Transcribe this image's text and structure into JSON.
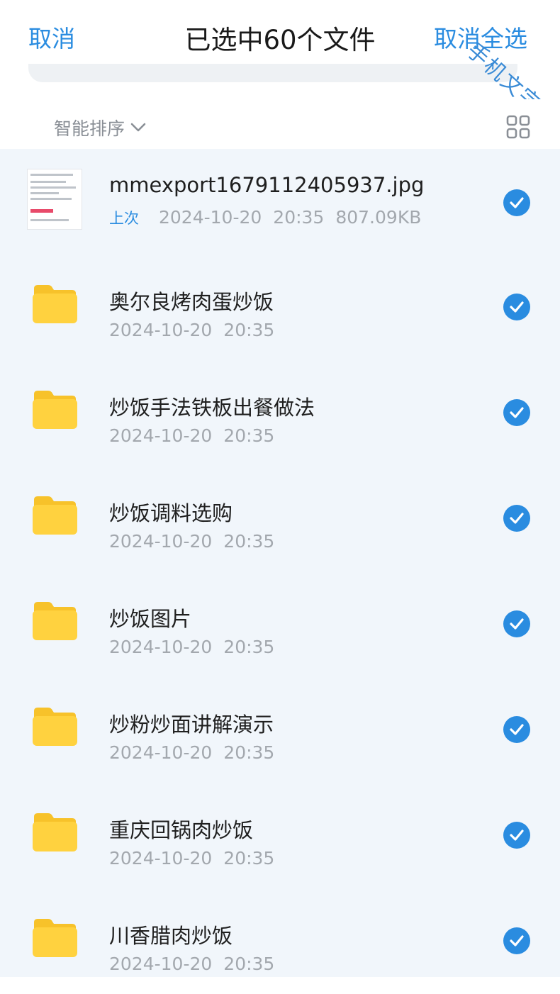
{
  "header": {
    "cancel_label": "取消",
    "title": "已选中60个文件",
    "deselect_all_label": "取消全选"
  },
  "watermark": "手机文字",
  "toolbar": {
    "sort_label": "智能排序",
    "sort_icon": "chevron-down-icon",
    "view_icon": "grid-view-icon"
  },
  "colors": {
    "accent": "#2a8ce0",
    "folder": "#ffd23f",
    "list_bg": "#f1f6fb"
  },
  "files": [
    {
      "type": "image",
      "name": "mmexport1679112405937.jpg",
      "tag": "上次",
      "date": "2024-10-20",
      "time": "20:35",
      "size": "807.09KB",
      "selected": true
    },
    {
      "type": "folder",
      "name": "奥尔良烤肉蛋炒饭",
      "date": "2024-10-20",
      "time": "20:35",
      "selected": true
    },
    {
      "type": "folder",
      "name": "炒饭手法铁板出餐做法",
      "date": "2024-10-20",
      "time": "20:35",
      "selected": true
    },
    {
      "type": "folder",
      "name": "炒饭调料选购",
      "date": "2024-10-20",
      "time": "20:35",
      "selected": true
    },
    {
      "type": "folder",
      "name": "炒饭图片",
      "date": "2024-10-20",
      "time": "20:35",
      "selected": true
    },
    {
      "type": "folder",
      "name": "炒粉炒面讲解演示",
      "date": "2024-10-20",
      "time": "20:35",
      "selected": true
    },
    {
      "type": "folder",
      "name": "重庆回锅肉炒饭",
      "date": "2024-10-20",
      "time": "20:35",
      "selected": true
    },
    {
      "type": "folder",
      "name": "川香腊肉炒饭",
      "date": "2024-10-20",
      "time": "20:35",
      "selected": true
    }
  ]
}
